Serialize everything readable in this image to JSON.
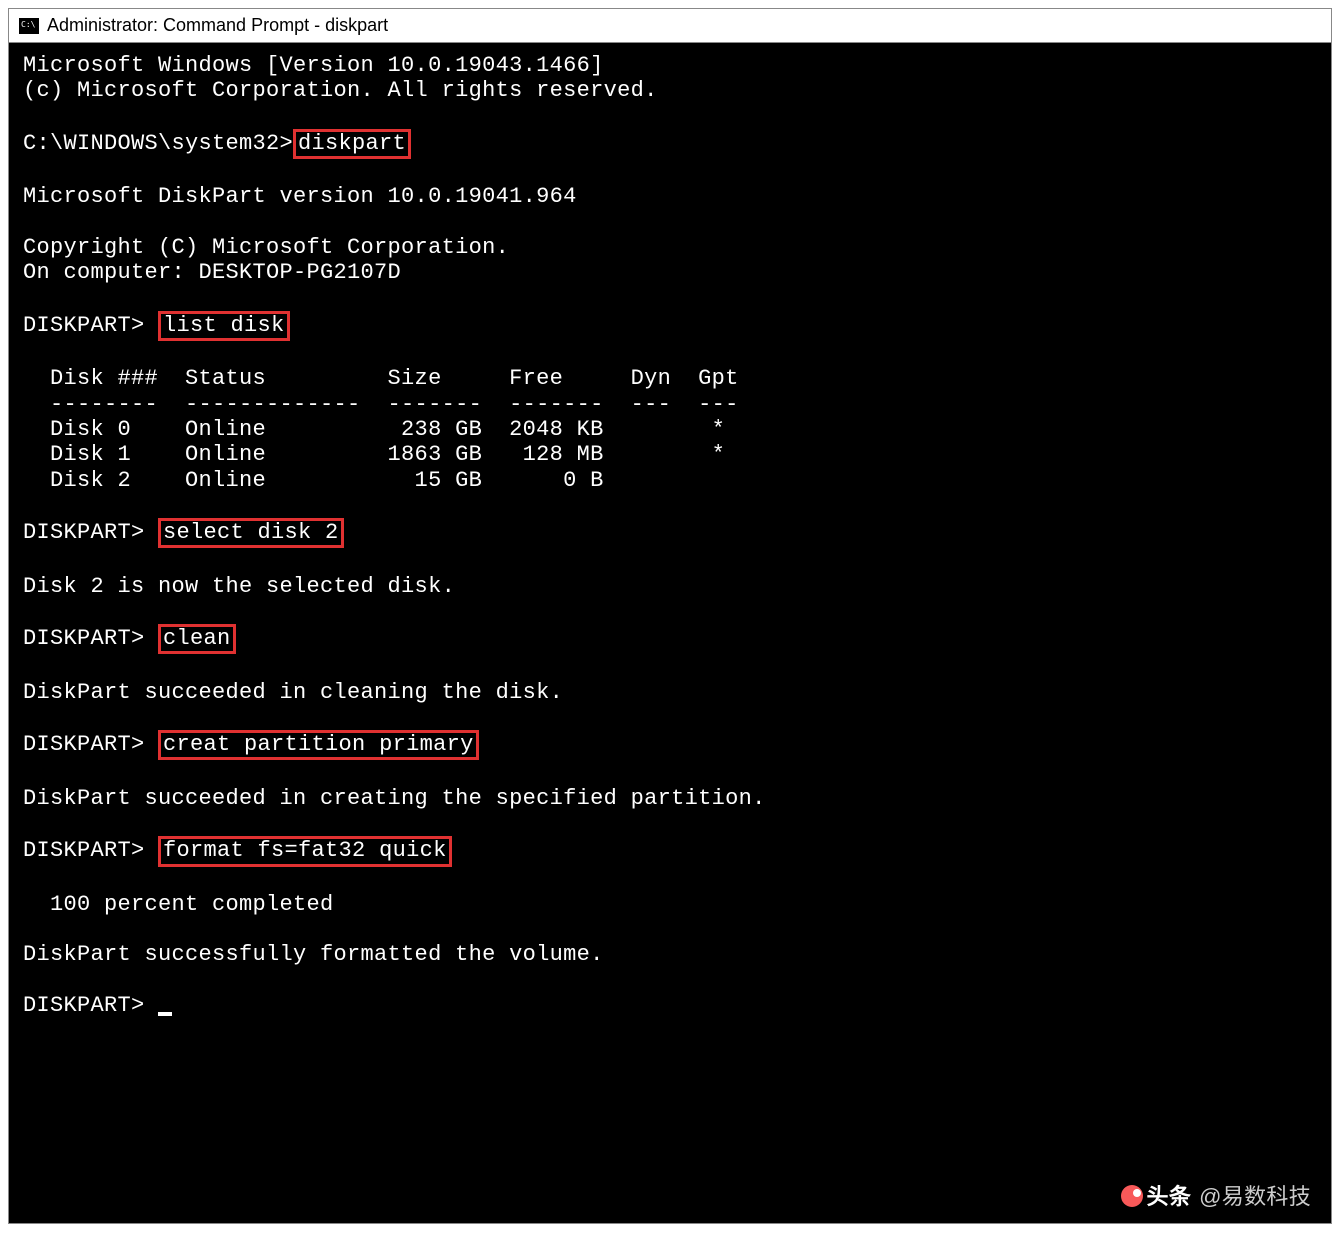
{
  "titlebar": {
    "title": "Administrator: Command Prompt - diskpart"
  },
  "terminal": {
    "header_line1": "Microsoft Windows [Version 10.0.19043.1466]",
    "header_line2": "(c) Microsoft Corporation. All rights reserved.",
    "prompt1_prefix": "C:\\WINDOWS\\system32>",
    "cmd1": "diskpart",
    "diskpart_version": "Microsoft DiskPart version 10.0.19041.964",
    "copyright": "Copyright (C) Microsoft Corporation.",
    "computer": "On computer: DESKTOP-PG2107D",
    "dp_prompt": "DISKPART> ",
    "cmd2": "list disk",
    "table_header": "  Disk ###  Status         Size     Free     Dyn  Gpt",
    "table_divider": "  --------  -------------  -------  -------  ---  ---",
    "table_rows": [
      "  Disk 0    Online          238 GB  2048 KB        *",
      "  Disk 1    Online         1863 GB   128 MB        *",
      "  Disk 2    Online           15 GB      0 B"
    ],
    "cmd3": "select disk 2",
    "resp3": "Disk 2 is now the selected disk.",
    "cmd4": "clean",
    "resp4": "DiskPart succeeded in cleaning the disk.",
    "cmd5": "creat partition primary",
    "resp5": "DiskPart succeeded in creating the specified partition.",
    "cmd6": "format fs=fat32 quick",
    "resp6a": "  100 percent completed",
    "resp6b": "DiskPart successfully formatted the volume."
  },
  "watermark": {
    "brand": "头条",
    "author": "@易数科技"
  }
}
